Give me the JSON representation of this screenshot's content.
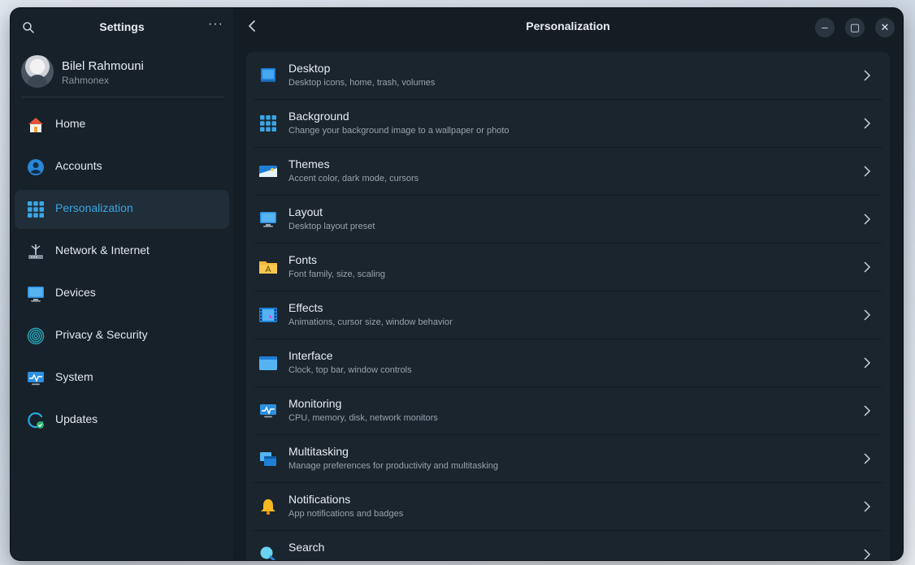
{
  "sidebar": {
    "title": "Settings",
    "more": "···",
    "profile": {
      "name": "Bilel Rahmouni",
      "username": "Rahmonex"
    },
    "items": [
      {
        "label": "Home",
        "icon": "home-icon",
        "active": false
      },
      {
        "label": "Accounts",
        "icon": "user-icon",
        "active": false
      },
      {
        "label": "Personalization",
        "icon": "grid-icon",
        "active": true
      },
      {
        "label": "Network & Internet",
        "icon": "network-icon",
        "active": false
      },
      {
        "label": "Devices",
        "icon": "monitor-icon",
        "active": false
      },
      {
        "label": "Privacy & Security",
        "icon": "fingerprint-icon",
        "active": false
      },
      {
        "label": "System",
        "icon": "system-monitor-icon",
        "active": false
      },
      {
        "label": "Updates",
        "icon": "update-icon",
        "active": false
      }
    ]
  },
  "main": {
    "title": "Personalization",
    "window_controls": {
      "minimize": "–",
      "maximize": "▢",
      "close": "✕"
    },
    "rows": [
      {
        "title": "Desktop",
        "subtitle": "Desktop icons, home, trash, volumes",
        "icon": "desktop-icon"
      },
      {
        "title": "Background",
        "subtitle": "Change your background image to a wallpaper or photo",
        "icon": "background-icon"
      },
      {
        "title": "Themes",
        "subtitle": "Accent color, dark mode, cursors",
        "icon": "themes-icon"
      },
      {
        "title": "Layout",
        "subtitle": "Desktop layout preset",
        "icon": "layout-icon"
      },
      {
        "title": "Fonts",
        "subtitle": "Font family, size, scaling",
        "icon": "fonts-icon"
      },
      {
        "title": "Effects",
        "subtitle": "Animations, cursor size, window behavior",
        "icon": "effects-icon"
      },
      {
        "title": "Interface",
        "subtitle": "Clock, top bar, window controls",
        "icon": "interface-icon"
      },
      {
        "title": "Monitoring",
        "subtitle": "CPU, memory, disk, network monitors",
        "icon": "monitoring-icon"
      },
      {
        "title": "Multitasking",
        "subtitle": "Manage preferences for productivity and multitasking",
        "icon": "multitasking-icon"
      },
      {
        "title": "Notifications",
        "subtitle": "App notifications and badges",
        "icon": "bell-icon"
      },
      {
        "title": "Search",
        "subtitle": "",
        "icon": "search-icon"
      }
    ]
  },
  "colors": {
    "accent": "#3aa6e6",
    "window_bg": "#151d24",
    "sidebar_bg": "#17212a",
    "list_bg": "#1b252e"
  }
}
